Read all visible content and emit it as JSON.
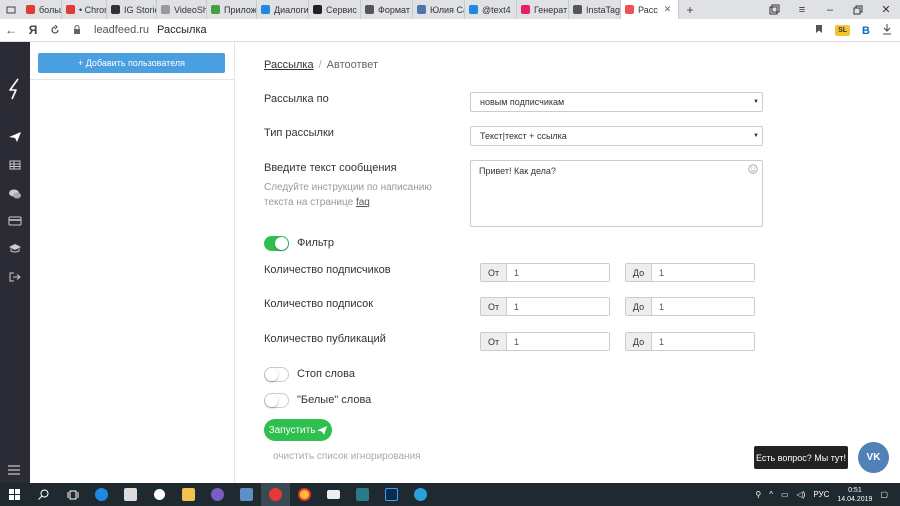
{
  "browser": {
    "tabs": [
      {
        "label": "большо",
        "color": "#e53935"
      },
      {
        "label": "• Chrom",
        "color": "#e53935"
      },
      {
        "label": "IG Storie",
        "color": "#333333"
      },
      {
        "label": "VideoSh",
        "color": "#999999"
      },
      {
        "label": "Прилож",
        "color": "#43a047"
      },
      {
        "label": "Диалоги",
        "color": "#1e88e5"
      },
      {
        "label": "Сервис",
        "color": "#222222"
      },
      {
        "label": "Формат",
        "color": "#555555"
      },
      {
        "label": "Юлия Са",
        "color": "#4a76a8"
      },
      {
        "label": "@text4",
        "color": "#1e88e5"
      },
      {
        "label": "Генерат",
        "color": "#e91e63"
      },
      {
        "label": "InstaTag",
        "color": "#555555"
      },
      {
        "label": "Расс",
        "color": "#ef5350"
      }
    ],
    "new_tab": "+",
    "address": {
      "domain": "leadfeed.ru",
      "title": "Рассылка"
    },
    "yandex_logo": "Я",
    "sl_badge": "SL",
    "b_icon": "B"
  },
  "sidebar": {
    "icons": [
      "logo-icon",
      "send-icon",
      "table-icon",
      "chat-icon",
      "card-icon",
      "graduation-icon",
      "logout-icon",
      "menu-icon"
    ]
  },
  "left_panel": {
    "add_user_label": "+ Добавить пользователя"
  },
  "breadcrumb": {
    "parent": "Рассылка",
    "separator": "/",
    "current": "Автоответ"
  },
  "form": {
    "mailing_by": {
      "label": "Рассылка по",
      "value": "новым подписчикам"
    },
    "mailing_type": {
      "label": "Тип рассылки",
      "value": "Текст|текст + ссылка"
    },
    "message": {
      "label": "Введите текст сообщения",
      "hint": "Следуйте инструкции по написанию текста на странице",
      "hint_link": "faq",
      "value": "Привет! Как дела?"
    },
    "filter": {
      "label": "Фильтр",
      "on": true
    },
    "subscribers": {
      "label": "Количество подписчиков",
      "from_label": "От",
      "from": "1",
      "to_label": "До",
      "to": "1"
    },
    "subscriptions": {
      "label": "Количество подписок",
      "from_label": "От",
      "from": "1",
      "to_label": "До",
      "to": "1"
    },
    "publications": {
      "label": "Количество публикаций",
      "from_label": "От",
      "from": "1",
      "to_label": "До",
      "to": "1"
    },
    "stop_words": {
      "label": "Стоп слова",
      "on": false
    },
    "white_words": {
      "label": "\"Белые\" слова",
      "on": false
    },
    "run_label": "Запустить",
    "clear_label": "очистить список игнорирования"
  },
  "chat": {
    "tooltip": "Есть вопрос? Мы тут!",
    "vk_label": "VK"
  },
  "taskbar": {
    "lang": "РУС",
    "time": "0:51",
    "date": "14.04.2019"
  },
  "colors": {
    "accent_green": "#2fbf4e",
    "accent_blue": "#4a9fe0",
    "sidebar_dark": "#2b2b35"
  }
}
